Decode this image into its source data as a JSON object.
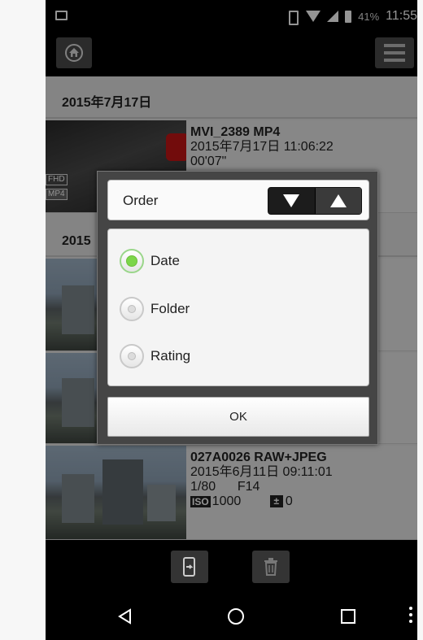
{
  "status_bar": {
    "battery_percent": "41%",
    "time": "11:55"
  },
  "toolbar": {
    "home_icon": "home-icon",
    "menu_icon": "hamburger-menu-icon"
  },
  "list": {
    "groups": [
      {
        "date_header": "2015年7月17日",
        "items": [
          {
            "name": "MVI_2389   MP4",
            "datetime": "2015年7月17日  11:06:22",
            "duration": "00'07\"",
            "badges": [
              "FHD",
              "MP4"
            ]
          }
        ]
      },
      {
        "date_header": "2015",
        "items": [
          {
            "name": "027A0026   RAW+JPEG",
            "datetime": "2015年6月11日  09:11:01",
            "shutter": "1/80",
            "aperture": "F14",
            "iso_label": "ISO",
            "iso_value": "1000",
            "ev_label": "±",
            "ev_value": "0"
          }
        ]
      }
    ]
  },
  "dialog": {
    "order_label": "Order",
    "sort_descending_icon": "triangle-down-icon",
    "sort_ascending_icon": "triangle-up-icon",
    "options": [
      {
        "label": "Date",
        "selected": true
      },
      {
        "label": "Folder",
        "selected": false
      },
      {
        "label": "Rating",
        "selected": false
      }
    ],
    "ok_label": "OK",
    "accent_color": "#7cd64a"
  },
  "action_bar": {
    "transfer_icon": "phone-transfer-icon",
    "delete_icon": "trash-icon"
  },
  "nav_bar": {
    "back_icon": "back-triangle-icon",
    "home_icon": "home-circle-icon",
    "recents_icon": "recents-square-icon",
    "overflow_icon": "overflow-dots-icon"
  }
}
